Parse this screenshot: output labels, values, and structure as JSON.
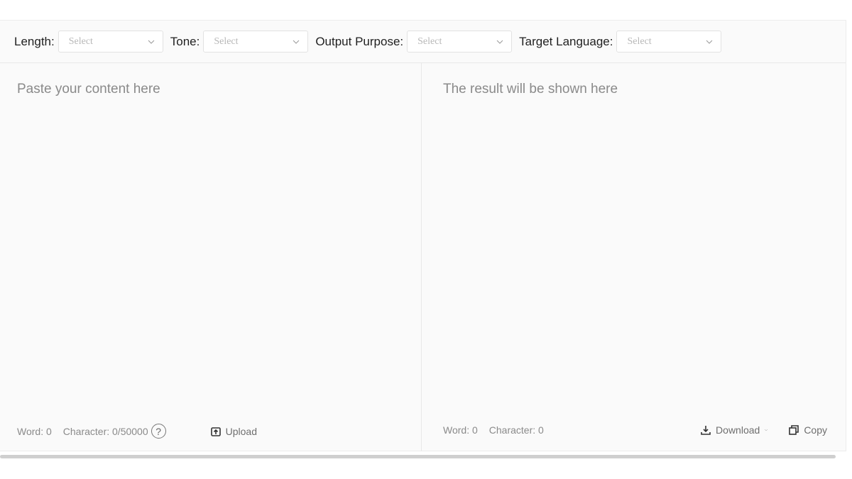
{
  "toolbar": {
    "options": [
      {
        "label": "Length:",
        "value": "Select"
      },
      {
        "label": "Tone:",
        "value": "Select"
      },
      {
        "label": "Output Purpose:",
        "value": "Select"
      },
      {
        "label": "Target Language:",
        "value": "Select"
      }
    ]
  },
  "input_pane": {
    "placeholder": "Paste your content here",
    "word_count": "Word: 0",
    "char_count": "Character: 0/50000",
    "help_symbol": "?",
    "upload_label": "Upload",
    "upload_icon": "upload-icon"
  },
  "output_pane": {
    "placeholder": "The result will be shown here",
    "word_count": "Word: 0",
    "char_count": "Character: 0",
    "download_label": "Download",
    "download_icon": "download-icon",
    "copy_label": "Copy",
    "copy_icon": "copy-icon"
  },
  "colors": {
    "placeholder_text": "#8a8a8a",
    "select_text": "#b8b8b8",
    "border": "#e8e8e8",
    "pane_background": "#fafafa"
  }
}
